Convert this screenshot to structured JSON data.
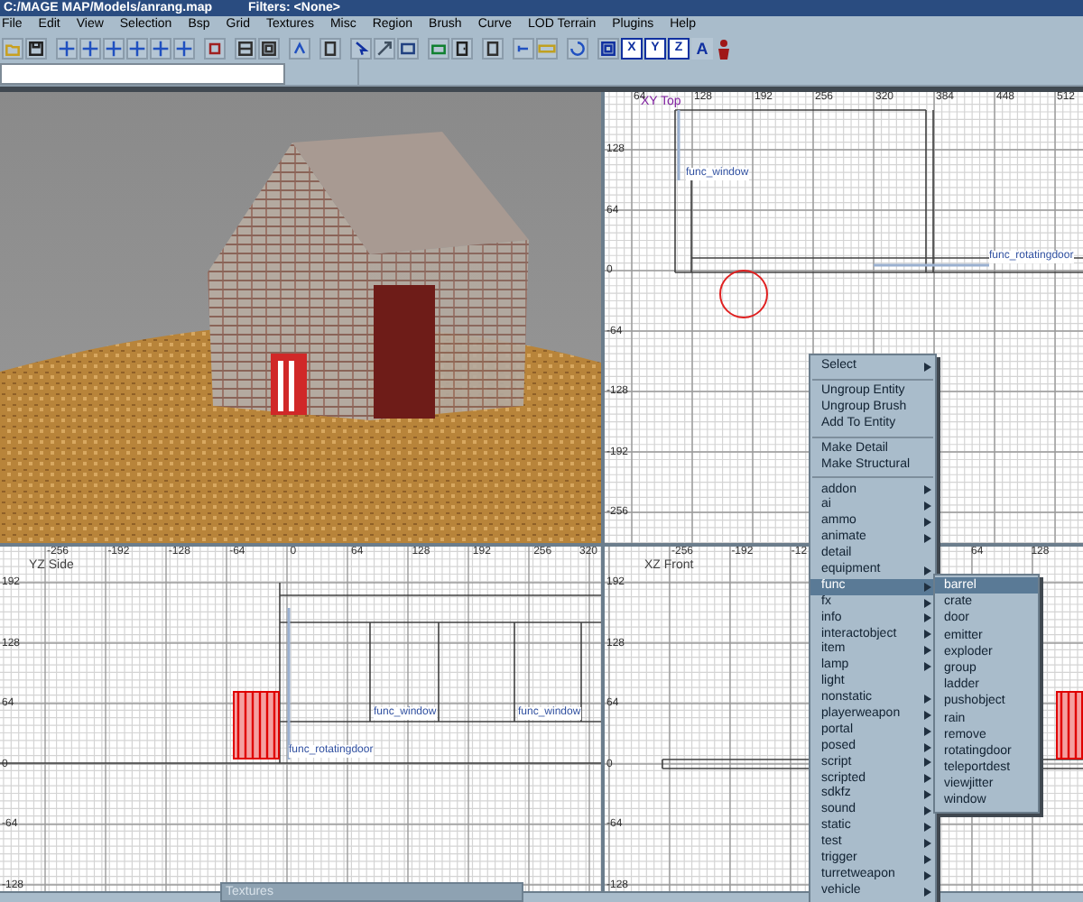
{
  "window": {
    "title": "C:/MAGE MAP/Models/anrang.map",
    "filters": "Filters: <None>"
  },
  "menubar": [
    "File",
    "Edit",
    "View",
    "Selection",
    "Bsp",
    "Grid",
    "Textures",
    "Misc",
    "Region",
    "Brush",
    "Curve",
    "LOD Terrain",
    "Plugins",
    "Help"
  ],
  "toolbar": {
    "axis_buttons": [
      "X",
      "Y",
      "Z"
    ],
    "letter_button": "A"
  },
  "views": [
    {
      "label": "XY Top",
      "x_ticks": [
        "64",
        "128",
        "192",
        "256",
        "320",
        "384",
        "448",
        "512"
      ],
      "y_ticks": [
        "128",
        "64",
        "0",
        "-64",
        "-128",
        "-192",
        "-256"
      ],
      "entities": [
        "func_window",
        "func_rotatingdoor"
      ]
    },
    {
      "label": "YZ Side",
      "x_ticks": [
        "-256",
        "-192",
        "-128",
        "-64",
        "0",
        "64",
        "128",
        "192",
        "256",
        "320"
      ],
      "y_ticks": [
        "192",
        "128",
        "64",
        "0",
        "-64",
        "-128"
      ],
      "entities": [
        "func_window",
        "func_window",
        "func_rotatingdoor"
      ]
    },
    {
      "label": "XZ Front",
      "x_ticks": [
        "-256",
        "-192",
        "-12",
        "64",
        "128"
      ],
      "y_ticks": [
        "192",
        "128",
        "64",
        "0",
        "-64",
        "-128"
      ]
    }
  ],
  "context_menu": {
    "sections": [
      [
        {
          "label": "Select",
          "submenu": true,
          "selected": false
        }
      ],
      [
        {
          "label": "Ungroup Entity",
          "submenu": false,
          "selected": false
        },
        {
          "label": "Ungroup Brush",
          "submenu": false,
          "selected": false
        },
        {
          "label": "Add To Entity",
          "submenu": false,
          "selected": false
        }
      ],
      [
        {
          "label": "Make Detail",
          "submenu": false,
          "selected": false
        },
        {
          "label": "Make Structural",
          "submenu": false,
          "selected": false
        }
      ],
      [
        {
          "label": "addon",
          "submenu": true,
          "selected": false
        },
        {
          "label": "ai",
          "submenu": true,
          "selected": false
        },
        {
          "label": "ammo",
          "submenu": true,
          "selected": false
        },
        {
          "label": "animate",
          "submenu": true,
          "selected": false
        },
        {
          "label": "detail",
          "submenu": false,
          "selected": false
        },
        {
          "label": "equipment",
          "submenu": true,
          "selected": false
        },
        {
          "label": "func",
          "submenu": true,
          "selected": true
        },
        {
          "label": "fx",
          "submenu": true,
          "selected": false
        },
        {
          "label": "info",
          "submenu": true,
          "selected": false
        },
        {
          "label": "interactobject",
          "submenu": true,
          "selected": false
        },
        {
          "label": "item",
          "submenu": true,
          "selected": false
        },
        {
          "label": "lamp",
          "submenu": true,
          "selected": false
        },
        {
          "label": "light",
          "submenu": false,
          "selected": false
        },
        {
          "label": "nonstatic",
          "submenu": true,
          "selected": false
        },
        {
          "label": "playerweapon",
          "submenu": true,
          "selected": false
        },
        {
          "label": "portal",
          "submenu": true,
          "selected": false
        },
        {
          "label": "posed",
          "submenu": true,
          "selected": false
        },
        {
          "label": "script",
          "submenu": true,
          "selected": false
        },
        {
          "label": "scripted",
          "submenu": true,
          "selected": false
        },
        {
          "label": "sdkfz",
          "submenu": true,
          "selected": false
        },
        {
          "label": "sound",
          "submenu": true,
          "selected": false
        },
        {
          "label": "static",
          "submenu": true,
          "selected": false
        },
        {
          "label": "test",
          "submenu": true,
          "selected": false
        },
        {
          "label": "trigger",
          "submenu": true,
          "selected": false
        },
        {
          "label": "turretweapon",
          "submenu": true,
          "selected": false
        },
        {
          "label": "vehicle",
          "submenu": true,
          "selected": false
        }
      ]
    ],
    "submenu": [
      {
        "label": "barrel",
        "selected": true
      },
      {
        "label": "crate",
        "selected": false
      },
      {
        "label": "door",
        "selected": false
      },
      {
        "label": "emitter",
        "selected": false
      },
      {
        "label": "exploder",
        "selected": false
      },
      {
        "label": "group",
        "selected": false
      },
      {
        "label": "ladder",
        "selected": false
      },
      {
        "label": "pushobject",
        "selected": false
      },
      {
        "label": "rain",
        "selected": false
      },
      {
        "label": "remove",
        "selected": false
      },
      {
        "label": "rotatingdoor",
        "selected": false
      },
      {
        "label": "teleportdest",
        "selected": false
      },
      {
        "label": "viewjitter",
        "selected": false
      },
      {
        "label": "window",
        "selected": false
      }
    ]
  },
  "textures_window": {
    "title": "Textures"
  }
}
